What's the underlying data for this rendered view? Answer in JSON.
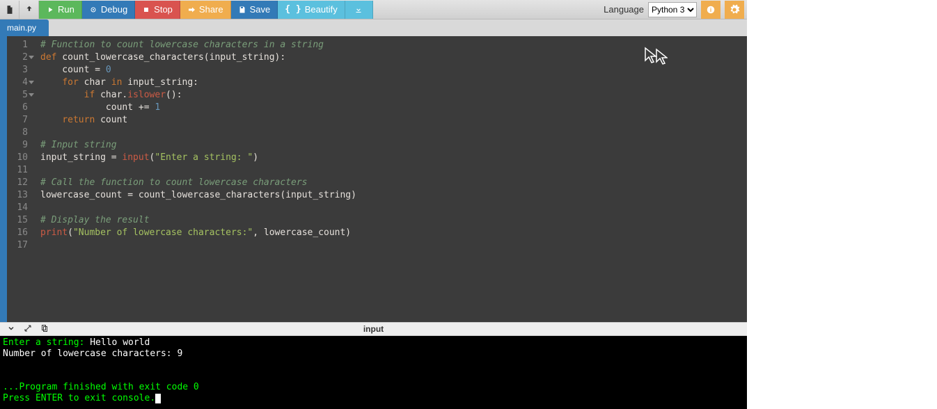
{
  "toolbar": {
    "run": "Run",
    "debug": "Debug",
    "stop": "Stop",
    "share": "Share",
    "save": "Save",
    "beautify": "Beautify",
    "language_label": "Language",
    "language_value": "Python 3"
  },
  "tabs": {
    "active": "main.py"
  },
  "editor": {
    "lines": [
      "# Function to count lowercase characters in a string",
      "def count_lowercase_characters(input_string):",
      "    count = 0",
      "    for char in input_string:",
      "        if char.islower():",
      "            count += 1",
      "    return count",
      "",
      "# Input string",
      "input_string = input(\"Enter a string: \")",
      "",
      "# Call the function to count lowercase characters",
      "lowercase_count = count_lowercase_characters(input_string)",
      "",
      "# Display the result",
      "print(\"Number of lowercase characters:\", lowercase_count)",
      ""
    ],
    "line_numbers": [
      "1",
      "2",
      "3",
      "4",
      "5",
      "6",
      "7",
      "8",
      "9",
      "10",
      "11",
      "12",
      "13",
      "14",
      "15",
      "16",
      "17"
    ],
    "fold_lines": [
      2,
      4,
      5
    ]
  },
  "console_bar": {
    "title": "input"
  },
  "console": {
    "l1a": "Enter a string: ",
    "l1b": "Hello world",
    "l2": "Number of lowercase characters: 9",
    "l3": "",
    "l4": "",
    "l5": "...Program finished with exit code 0",
    "l6": "Press ENTER to exit console."
  }
}
